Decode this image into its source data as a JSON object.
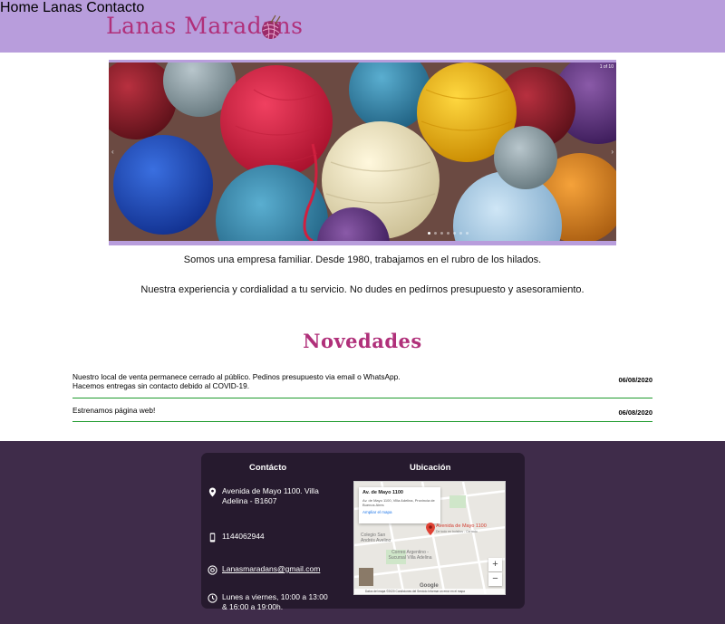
{
  "header": {
    "logo_text": "Lanas Maradans",
    "nav": [
      {
        "label": "Home"
      },
      {
        "label": "Lanas"
      },
      {
        "label": "Contacto"
      }
    ],
    "colors": {
      "background": "#b89ddc",
      "logo": "#b0307a"
    }
  },
  "slider": {
    "counter": "1 of 10",
    "current_slide": 1,
    "total_slides": 10,
    "prev_icon": "chevron-left-icon",
    "next_icon": "chevron-right-icon"
  },
  "intro": {
    "line1": "Somos una empresa familiar. Desde 1980, trabajamos en el rubro de los hilados.",
    "line2": "Nuestra experiencia y cordialidad a tu servicio. No dudes en pedírnos presupuesto y asesoramiento."
  },
  "novedades": {
    "title": "Novedades",
    "items": [
      {
        "text": "Nuestro local de venta permanece cerrado al público. Pedinos presupuesto via email o WhatsApp.\nHacemos entregas sin contacto debido al COVID-19.",
        "date": "06/08/2020"
      },
      {
        "text": "Estrenamos página web!",
        "date": "06/08/2020"
      }
    ]
  },
  "footer": {
    "contact_title": "Contácto",
    "location_title": "Ubicación",
    "address": "Avenida de Mayo 1100. Villa Adelina - B1607",
    "phone": "1144062944",
    "email": "Lanasmaradans@gmail.com",
    "hours": "Lunes a viernes, 10:00 a 13:00 & 16:00 a 19:00h.",
    "icons": {
      "address": "location-pin-icon",
      "phone": "phone-icon",
      "email": "at-sign-icon",
      "hours": "clock-icon"
    }
  },
  "map": {
    "info_title": "Av. de Mayo 1100",
    "info_address": "Av. de Mayo 1100, Villa Adelina, Provincia de Buenos Aires",
    "info_link": "Ampliar el mapa",
    "marker_label": "Avenida de Mayo 1100",
    "marker_sub": "De todo en bolsitos - Cerrado",
    "place_1": "Colegio San Andrés Avelino",
    "place_2": "Correo Argentino - Sucursal Villa Adelina",
    "zoom_in": "+",
    "zoom_out": "−",
    "footer_text": "Datos del mapa ©2020   Condiciones del Servicio   Informar un error en el mapa",
    "google": "Google"
  }
}
